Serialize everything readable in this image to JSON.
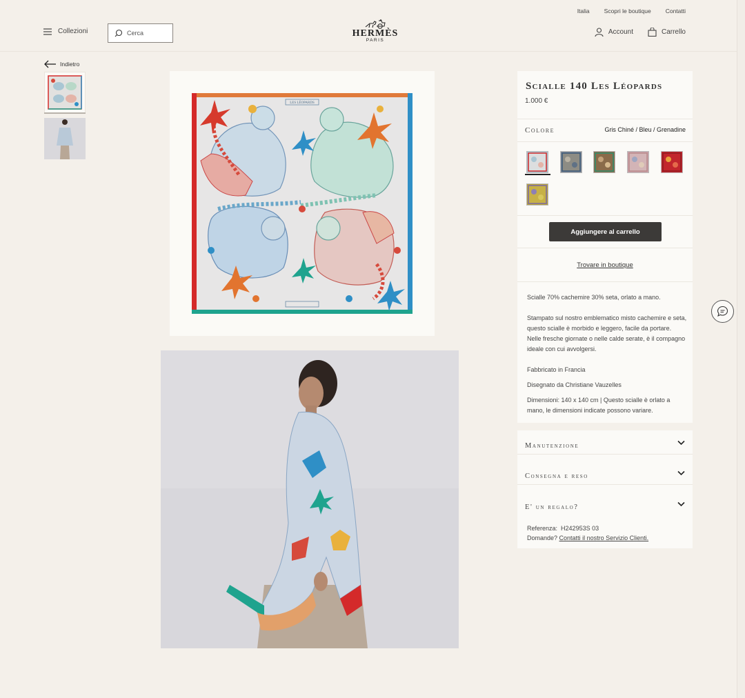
{
  "header": {
    "util_links": [
      "Italia",
      "Scopri le boutique",
      "Contatti"
    ],
    "menu_label": "Collezioni",
    "search_placeholder": "Cerca",
    "logo": {
      "brand": "HERMÈS",
      "city": "PARIS"
    },
    "account_label": "Account",
    "cart_label": "Carrello"
  },
  "back_label": "Indietro",
  "product": {
    "title": "Scialle 140 Les Léopards",
    "price": "1.000 €",
    "color_label": "Colore",
    "color_value": "Gris Chiné / Bleu / Grenadine",
    "swatches": [
      {
        "name": "Gris Chiné / Bleu / Grenadine",
        "color": "#a9c6d3"
      },
      {
        "name": "variant-2",
        "color": "#7e8793"
      },
      {
        "name": "variant-3",
        "color": "#8a6b4a"
      },
      {
        "name": "variant-4",
        "color": "#c9a1a8"
      },
      {
        "name": "variant-5",
        "color": "#c2262d"
      },
      {
        "name": "variant-6",
        "color": "#b8a23c"
      }
    ],
    "add_to_cart": "Aggiungere al carrello",
    "find_in_boutique": "Trovare in boutique",
    "description": [
      "Scialle 70% cachemire 30% seta, orlato a mano.",
      "Stampato sul nostro emblematico misto cachemire e seta, questo scialle è morbido e leggero, facile da portare. Nelle fresche giornate o nelle calde serate, è il compagno ideale con cui avvolgersi.",
      "Fabbricato in Francia",
      "Disegnato da Christiane Vauzelles",
      "Dimensioni: 140 x 140 cm | Questo scialle è orlato a mano, le dimensioni indicate possono variare."
    ]
  },
  "accordion": [
    "Manutenzione",
    "Consegna e reso",
    "E' un regalo?"
  ],
  "reference": {
    "label": "Referenza:",
    "value": "H242953S 03",
    "question": "Domande?",
    "link": "Contatti il nostro Servizio Clienti."
  },
  "scarf_print_label": "LES LÉOPARDS",
  "colors": {
    "background": "#f4f0ea",
    "panel": "#fbfaf7",
    "button": "#3c3a38",
    "scarf_border_left": "#d42a2a",
    "scarf_border_right": "#2f8fc6",
    "scarf_border_top": "#e07a3a",
    "scarf_border_bottom": "#1fa38e"
  }
}
